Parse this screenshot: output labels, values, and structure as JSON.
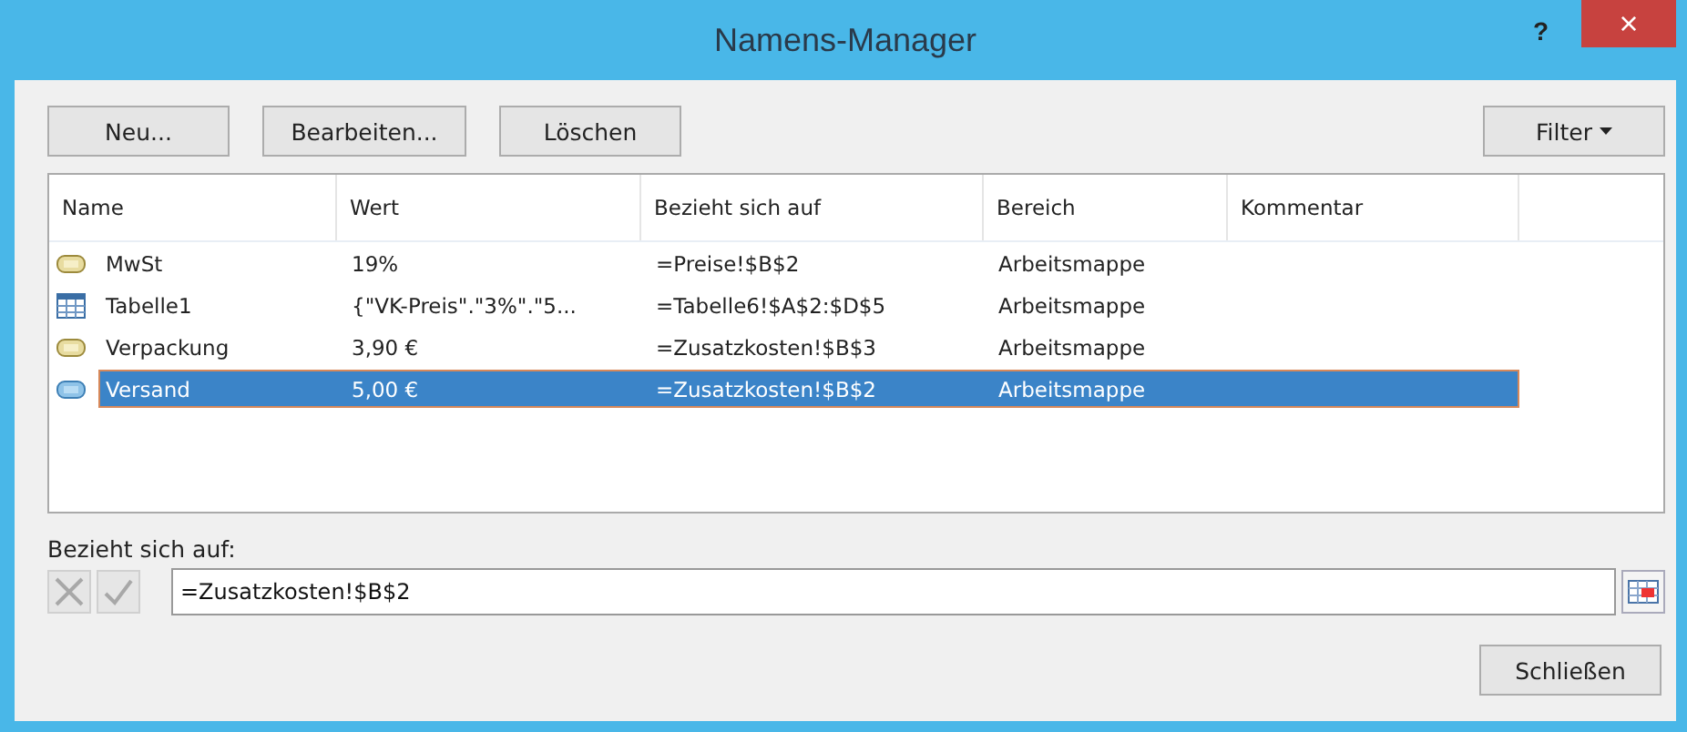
{
  "window": {
    "title": "Namens-Manager",
    "help": "?",
    "close": "×"
  },
  "toolbar": {
    "buttons": [
      "Neu...",
      "Bearbeiten...",
      "Löschen"
    ],
    "filter": "Filter"
  },
  "table": {
    "columns": [
      "Name",
      "Wert",
      "Bezieht sich auf",
      "Bereich",
      "Kommentar"
    ],
    "rows": [
      {
        "kind": "name",
        "name": "MwSt",
        "value": "19%",
        "refers_to": "=Preise!$B$2",
        "scope": "Arbeitsmappe",
        "selected": false
      },
      {
        "kind": "table",
        "name": "Tabelle1",
        "value": "{\"VK-Preis\".\"3%\".\"5...",
        "refers_to": "=Tabelle6!$A$2:$D$5",
        "scope": "Arbeitsmappe",
        "selected": false
      },
      {
        "kind": "name",
        "name": "Verpackung",
        "value": "3,90 €",
        "refers_to": "=Zusatzkosten!$B$3",
        "scope": "Arbeitsmappe",
        "selected": false
      },
      {
        "kind": "name",
        "name": "Versand",
        "value": "5,00 €",
        "refers_to": "=Zusatzkosten!$B$2",
        "scope": "Arbeitsmappe",
        "selected": true
      }
    ]
  },
  "refers_to": {
    "label": "Bezieht sich auf:",
    "value": "=Zusatzkosten!$B$2"
  },
  "footer": {
    "close_button": "Schließen"
  }
}
